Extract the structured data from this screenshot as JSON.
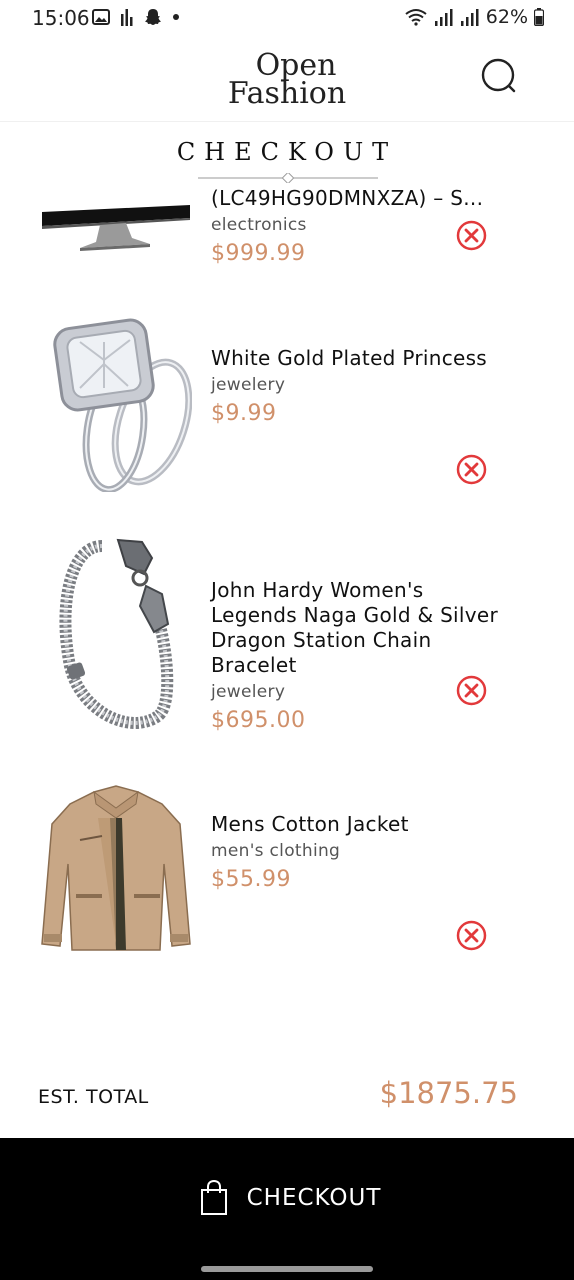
{
  "status_bar": {
    "time": "15:06",
    "battery": "62%",
    "icons": [
      "gallery-icon",
      "signal-bars-icon",
      "snapchat-icon",
      "dot-icon",
      "wifi-icon",
      "cell-signal-icon",
      "cell-signal-icon",
      "battery-icon"
    ]
  },
  "header": {
    "logo_line1": "Open",
    "logo_line2": "Fashion",
    "search_icon": "search-icon"
  },
  "page": {
    "title": "CHECKOUT"
  },
  "cart": {
    "items": [
      {
        "name": "(LC49HG90DMNXZA) – S...",
        "category": "electronics",
        "price": "$999.99",
        "image": "monitor"
      },
      {
        "name": "White Gold Plated Princess",
        "category": "jewelery",
        "price": "$9.99",
        "image": "ring"
      },
      {
        "name": "John Hardy Women's Legends Naga Gold & Silver Dragon Station Chain Bracelet",
        "category": "jewelery",
        "price": "$695.00",
        "image": "bracelet"
      },
      {
        "name": "Mens Cotton Jacket",
        "category": "men's clothing",
        "price": "$55.99",
        "image": "jacket"
      }
    ],
    "remove_icon": "remove-circle-icon"
  },
  "total": {
    "label": "EST. TOTAL",
    "value": "$1875.75"
  },
  "checkout_button": {
    "label": "CHECKOUT",
    "icon": "shopping-bag-icon"
  },
  "colors": {
    "price": "#d0906a",
    "remove": "#e2393b",
    "checkout_bg": "#000000"
  }
}
